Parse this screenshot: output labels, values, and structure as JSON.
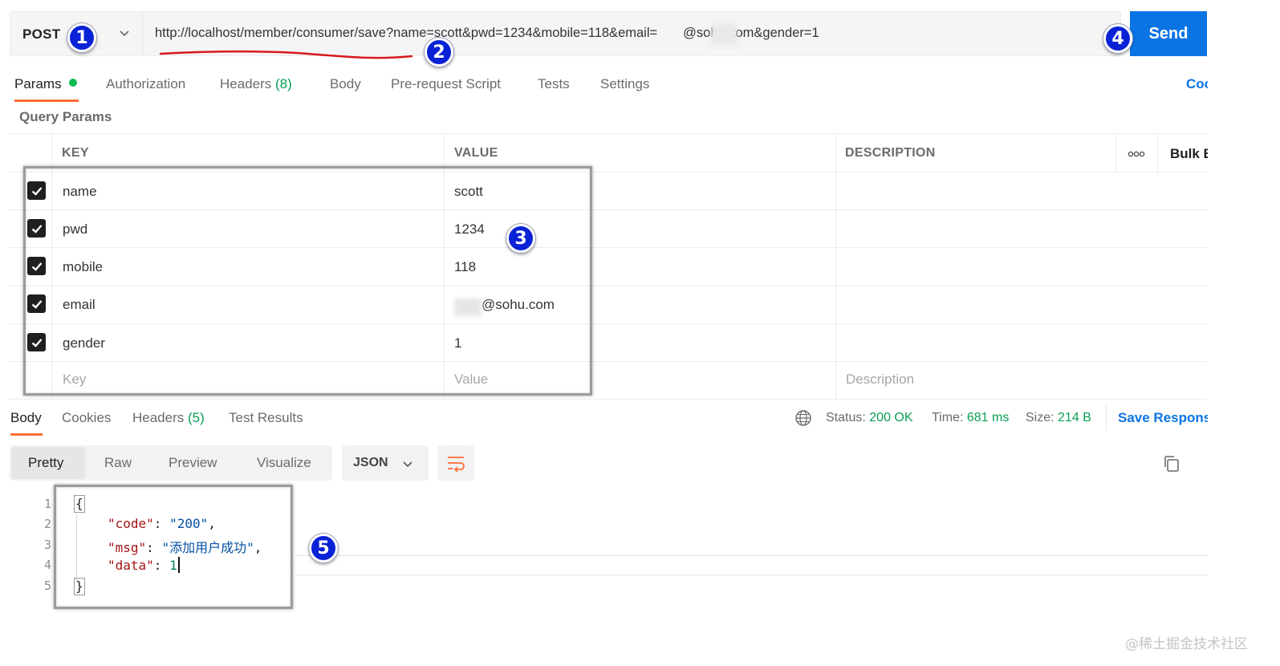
{
  "request": {
    "method": "POST",
    "url": "http://localhost/member/consumer/save?name=scott&pwd=1234&mobile=118&email=",
    "url_tail": "@sohu.com&gender=1",
    "send_label": "Send"
  },
  "request_tabs": {
    "params": "Params",
    "authorization": "Authorization",
    "headers": "Headers",
    "headers_count": "(8)",
    "body": "Body",
    "prerequest": "Pre-request Script",
    "tests": "Tests",
    "settings": "Settings",
    "cookies": "Cookies"
  },
  "params": {
    "section_title": "Query Params",
    "headers": {
      "key": "KEY",
      "value": "VALUE",
      "description": "DESCRIPTION",
      "bulk_edit": "Bulk Edit"
    },
    "rows": [
      {
        "key": "name",
        "value": "scott",
        "checked": true
      },
      {
        "key": "pwd",
        "value": "1234",
        "checked": true
      },
      {
        "key": "mobile",
        "value": "118",
        "checked": true
      },
      {
        "key": "email",
        "value": "@sohu.com",
        "checked": true
      },
      {
        "key": "gender",
        "value": "1",
        "checked": true
      }
    ],
    "placeholders": {
      "key": "Key",
      "value": "Value",
      "description": "Description"
    }
  },
  "response": {
    "tabs": {
      "body": "Body",
      "cookies": "Cookies",
      "headers": "Headers",
      "headers_count": "(5)",
      "test_results": "Test Results"
    },
    "status_label": "Status:",
    "status_value": "200 OK",
    "time_label": "Time:",
    "time_value": "681 ms",
    "size_label": "Size:",
    "size_value": "214 B",
    "save_response": "Save Response",
    "view_modes": [
      "Pretty",
      "Raw",
      "Preview",
      "Visualize"
    ],
    "format": "JSON",
    "line_numbers": [
      "1",
      "2",
      "3",
      "4",
      "5"
    ],
    "json": {
      "open_brace": "{",
      "close_brace": "}",
      "code_key": "\"code\"",
      "code_val": "\"200\"",
      "msg_key": "\"msg\"",
      "msg_val": "\"添加用户成功\"",
      "data_key": "\"data\"",
      "data_val": "1",
      "colon": ": ",
      "comma": ","
    }
  },
  "annotations": [
    "1",
    "2",
    "3",
    "4",
    "5"
  ],
  "watermark": "@稀土掘金技术社区",
  "colors": {
    "send": "#0b74e5",
    "accent_tab": "#ff6c37",
    "status_ok": "#0a9e53",
    "badge": "#0a22d6",
    "annotation_line": "#d7191c"
  }
}
